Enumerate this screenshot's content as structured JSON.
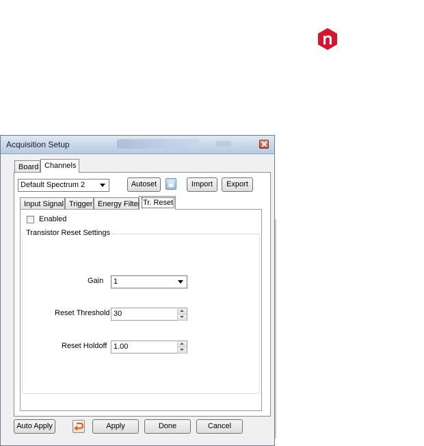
{
  "window": {
    "title": "Acquisition Setup"
  },
  "top_tabs": [
    {
      "label": "Board"
    },
    {
      "label": "Channels"
    }
  ],
  "toolbar": {
    "spectrum_select": "Default Spectrum 2",
    "autoset_label": "Autoset",
    "import_label": "Import",
    "export_label": "Export"
  },
  "sub_tabs": [
    {
      "label": "Input Signal"
    },
    {
      "label": "Trigger"
    },
    {
      "label": "Energy Filter"
    },
    {
      "label": "Tr. Reset"
    }
  ],
  "reset": {
    "enabled_label": "Enabled",
    "enabled_checked": false,
    "group_title": "Transistor Reset Settings",
    "gain_label": "Gain",
    "gain_value": "1",
    "threshold_label": "Reset Threshold",
    "threshold_value": "30",
    "holdoff_label": "Reset Holdoff",
    "holdoff_value": "1.00"
  },
  "bottom": {
    "auto_apply_label": "Auto Apply",
    "apply_label": "Apply",
    "done_label": "Done",
    "cancel_label": "Cancel"
  },
  "icons": {
    "logo": "brand-logo-icon",
    "close": "close-icon",
    "lock": "lock-icon",
    "undo": "undo-icon"
  },
  "colors": {
    "logo_red": "#d3172e",
    "accent_orange": "#e8641e"
  }
}
